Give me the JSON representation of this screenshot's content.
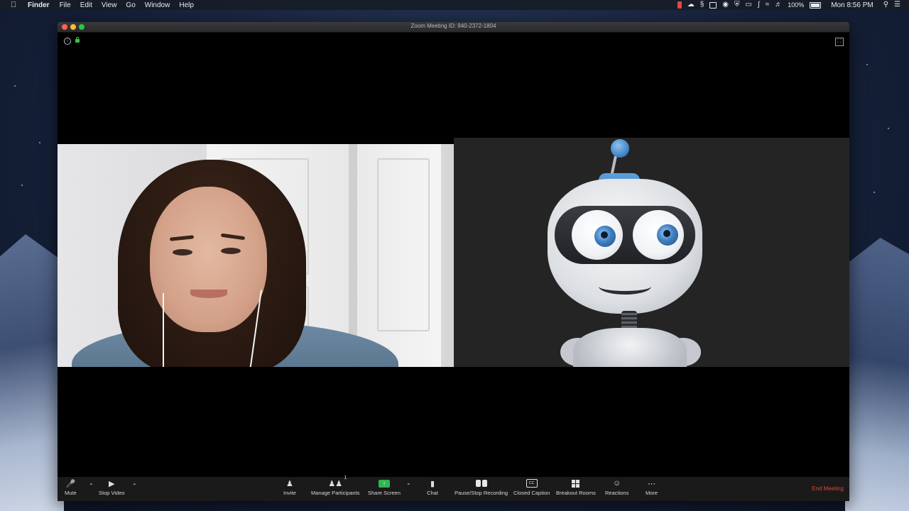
{
  "menubar": {
    "app_name": "Finder",
    "items": [
      "File",
      "Edit",
      "View",
      "Go",
      "Window",
      "Help"
    ],
    "battery_percent": "100%",
    "clock": "Mon 8:56 PM"
  },
  "window": {
    "title": "Zoom Meeting ID: 940-2372-1804"
  },
  "toolbar": {
    "mute_label": "Mute",
    "stop_video_label": "Stop Video",
    "invite_label": "Invite",
    "manage_participants_label": "Manage Participants",
    "participant_count": "1",
    "share_screen_label": "Share Screen",
    "chat_label": "Chat",
    "recording_label": "Pause/Stop Recording",
    "closed_caption_label": "Closed Caption",
    "closed_caption_icon_text": "CC",
    "breakout_rooms_label": "Breakout Rooms",
    "reactions_label": "Reactions",
    "more_label": "More",
    "end_meeting_label": "End Meeting"
  },
  "colors": {
    "end_meeting": "#e0453a",
    "share_screen": "#2fb552",
    "toolbar_bg": "#1a1a1a"
  }
}
